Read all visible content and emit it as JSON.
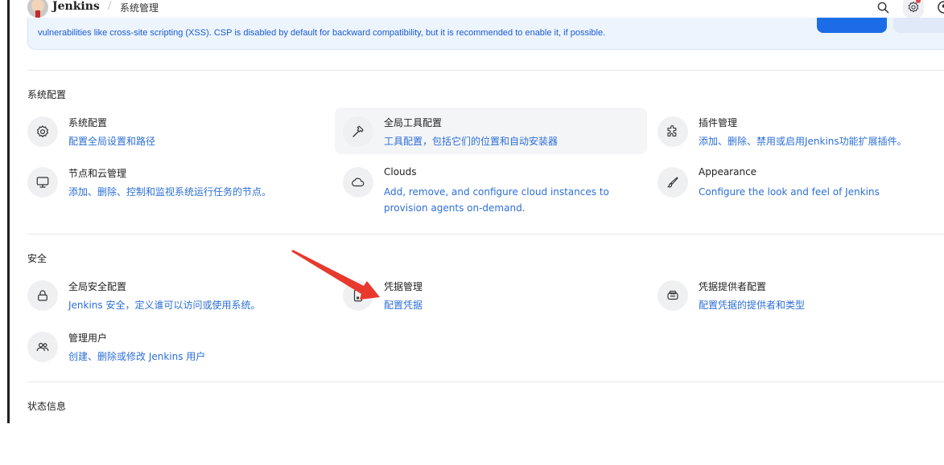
{
  "header": {
    "brand": "Jenkins",
    "breadcrumb_sep": "/",
    "breadcrumb": "系统管理"
  },
  "banner": {
    "text": "vulnerabilities like cross-site scripting (XSS). CSP is disabled by default for backward compatibility, but it is recommended to enable it, if possible."
  },
  "sections": {
    "system": {
      "title": "系统配置",
      "items": [
        {
          "icon": "gear-icon",
          "title": "系统配置",
          "desc": "配置全局设置和路径"
        },
        {
          "icon": "hammer-icon",
          "title": "全局工具配置",
          "desc": "工具配置，包括它们的位置和自动安装器"
        },
        {
          "icon": "puzzle-icon",
          "title": "插件管理",
          "desc": "添加、删除、禁用或启用Jenkins功能扩展插件。"
        },
        {
          "icon": "monitor-icon",
          "title": "节点和云管理",
          "desc": "添加、删除、控制和监视系统运行任务的节点。"
        },
        {
          "icon": "cloud-icon",
          "title": "Clouds",
          "desc": "Add, remove, and configure cloud instances to provision agents on-demand."
        },
        {
          "icon": "brush-icon",
          "title": "Appearance",
          "desc": "Configure the look and feel of Jenkins"
        }
      ]
    },
    "security": {
      "title": "安全",
      "items": [
        {
          "icon": "lock-icon",
          "title": "全局安全配置",
          "desc": "Jenkins 安全，定义谁可以访问或使用系统。"
        },
        {
          "icon": "credentials-icon",
          "title": "凭据管理",
          "desc": "配置凭据"
        },
        {
          "icon": "vault-icon",
          "title": "凭据提供者配置",
          "desc": "配置凭据的提供者和类型"
        },
        {
          "icon": "users-icon",
          "title": "管理用户",
          "desc": "创建、删除或修改 Jenkins 用户"
        }
      ]
    },
    "status": {
      "title": "状态信息"
    }
  },
  "colors": {
    "link": "#2c6fd6",
    "banner_bg": "#ecf4fe",
    "annotation_arrow": "#e8392e"
  }
}
